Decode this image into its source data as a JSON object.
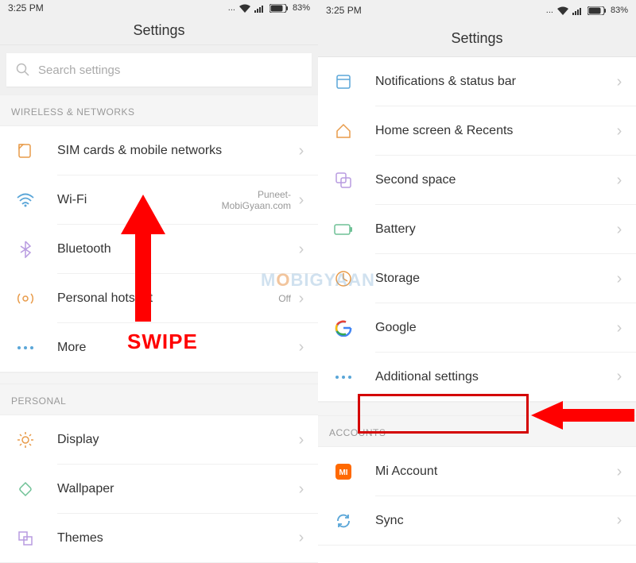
{
  "status": {
    "time": "3:25 PM",
    "battery": "83%"
  },
  "title": "Settings",
  "search": {
    "placeholder": "Search settings"
  },
  "left": {
    "section_wireless": "WIRELESS & NETWORKS",
    "sim": "SIM cards & mobile networks",
    "wifi": "Wi-Fi",
    "wifi_value": "Puneet-MobiGyaan.com",
    "bluetooth": "Bluetooth",
    "hotspot": "Personal hotspot",
    "hotspot_value": "Off",
    "more": "More",
    "section_personal": "PERSONAL",
    "display": "Display",
    "wallpaper": "Wallpaper",
    "themes": "Themes"
  },
  "right": {
    "notifications": "Notifications & status bar",
    "home": "Home screen & Recents",
    "second_space": "Second space",
    "battery": "Battery",
    "storage": "Storage",
    "google": "Google",
    "additional": "Additional settings",
    "section_accounts": "ACCOUNTS",
    "mi_account": "Mi Account",
    "sync": "Sync"
  },
  "annotation": {
    "swipe": "SWIPE"
  },
  "watermark": {
    "a": "M",
    "b": "O",
    "c": "BIGYAAN"
  }
}
